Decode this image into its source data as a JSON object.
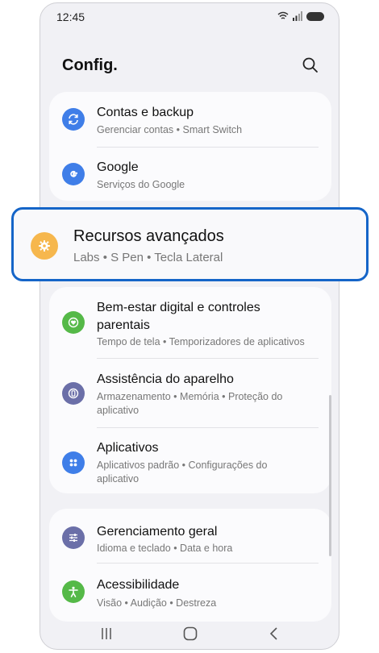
{
  "status": {
    "time": "12:45"
  },
  "header": {
    "title": "Config."
  },
  "card1": {
    "items": [
      {
        "title": "Contas e backup",
        "subtitle": "Gerenciar contas • Smart Switch"
      },
      {
        "title": "Google",
        "subtitle": "Serviços do Google"
      }
    ]
  },
  "highlight": {
    "title": "Recursos avançados",
    "subtitle": "Labs • S Pen • Tecla Lateral"
  },
  "card2": {
    "items": [
      {
        "title_line1": "Bem-estar digital e controles",
        "title_line2": "parentais",
        "subtitle": "Tempo de tela • Temporizadores de aplicativos"
      },
      {
        "title": "Assistência do aparelho",
        "subtitle_line1": "Armazenamento • Memória • Proteção do",
        "subtitle_line2": "aplicativo"
      },
      {
        "title": "Aplicativos",
        "subtitle_line1": "Aplicativos padrão • Configurações do",
        "subtitle_line2": "aplicativo"
      }
    ]
  },
  "card3": {
    "items": [
      {
        "title": "Gerenciamento geral",
        "subtitle": "Idioma e teclado • Data e hora"
      },
      {
        "title": "Acessibilidade",
        "subtitle": "Visão • Audição • Destreza"
      }
    ]
  },
  "colors": {
    "accounts_icon": "#3f7ee8",
    "google_icon": "#3f7ee8",
    "advanced_icon": "#f6b74d",
    "wellbeing_icon": "#55b948",
    "device_care_icon": "#6b6fa8",
    "apps_icon": "#3f7ee8",
    "general_icon": "#6b6fa8",
    "accessibility_icon": "#55b948",
    "highlight_border": "#1565c8"
  }
}
